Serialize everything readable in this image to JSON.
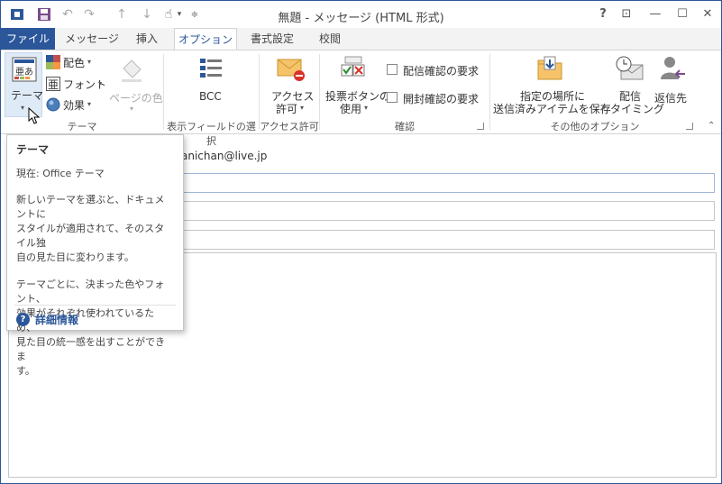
{
  "window": {
    "title": "無題 - メッセージ (HTML 形式)",
    "help": "?",
    "ribbon_display": "⊡",
    "minimize": "—",
    "maximize": "☐",
    "close": "✕"
  },
  "qat": {
    "more": "▾"
  },
  "tabs": [
    {
      "label": "ファイル"
    },
    {
      "label": "メッセージ"
    },
    {
      "label": "挿入"
    },
    {
      "label": "オプション"
    },
    {
      "label": "書式設定"
    },
    {
      "label": "校閲"
    }
  ],
  "ribbon": {
    "theme": {
      "theme_btn": "テーマ",
      "colors": "配色",
      "fonts": "フォント",
      "effects": "効果",
      "page_color": "ページの色",
      "group": "テーマ"
    },
    "fields": {
      "bcc": "BCC",
      "group": "表示フィールドの選択"
    },
    "permission": {
      "line1": "アクセス",
      "line2": "許可",
      "group": "アクセス許可"
    },
    "tracking": {
      "voting_line1": "投票ボタンの",
      "voting_line2": "使用",
      "delivery": "配信確認の要求",
      "read": "開封確認の要求",
      "group": "確認"
    },
    "more": {
      "save_line1": "指定の場所に",
      "save_line2": "送信済みアイテムを保存",
      "delay_line1": "配信",
      "delay_line2": "タイミング",
      "reply": "返信先",
      "group": "その他のオプション"
    }
  },
  "form": {
    "from": "anichan@live.jp"
  },
  "tooltip": {
    "title": "テーマ",
    "current": "現在: Office テーマ",
    "para1_line1": "新しいテーマを選ぶと、ドキュメントに",
    "para1_line2": "スタイルが適用されて、そのスタイル独",
    "para1_line3": "自の見た目に変わります。",
    "para2_line1": "テーマごとに、決まった色やフォント、",
    "para2_line2": "効果がそれぞれ使われているため、",
    "para2_line3": "見た目の統一感を出すことができま",
    "para2_line4": "す。",
    "help": "詳細情報"
  },
  "colors": {
    "accent": "#2b579a",
    "tab_bg": "#f3f3f3"
  }
}
